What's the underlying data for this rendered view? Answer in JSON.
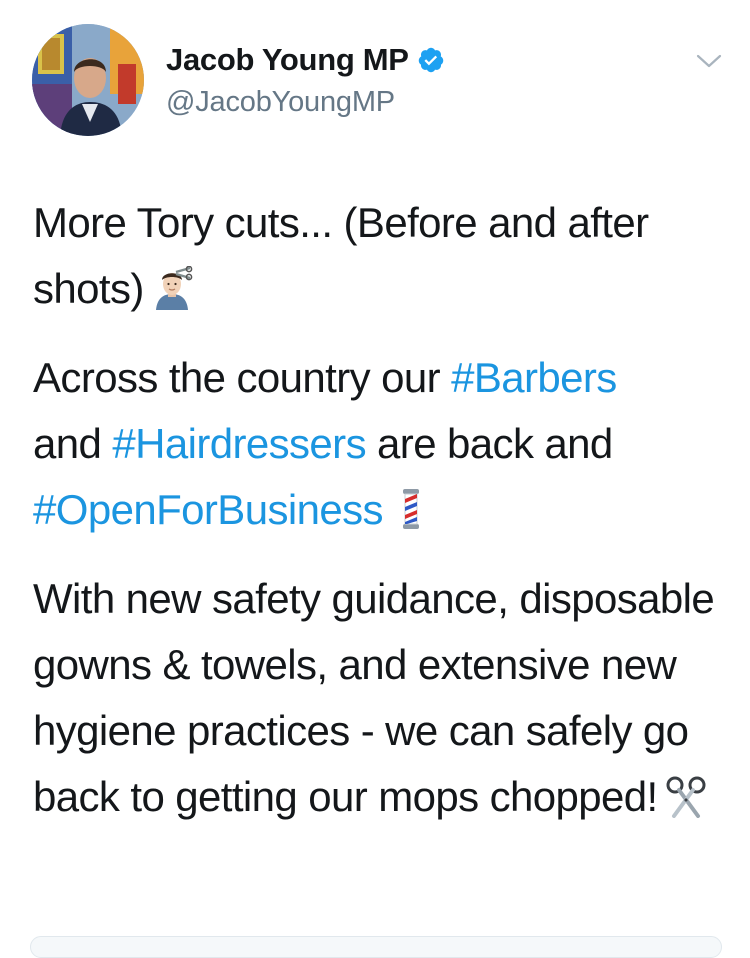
{
  "header": {
    "display_name": "Jacob Young MP",
    "handle": "@JacobYoungMP",
    "verified_icon": "verified-badge-icon",
    "menu_icon": "chevron-down-icon"
  },
  "tweet": {
    "p1_text": "More Tory cuts... (Before and after shots)",
    "p1_emoji": "haircut-icon",
    "p2_text_a": "Across the country our ",
    "p2_hashtag_1": "#Barbers",
    "p2_text_b": "and ",
    "p2_hashtag_2": "#Hairdressers",
    "p2_text_c": " are back and",
    "p2_hashtag_3": "#OpenForBusiness",
    "p2_emoji": "barber-pole-icon",
    "p3_text": "With new safety guidance, disposable gowns & towels, and extensive new hygiene practices - we can safely go back to getting our mops chopped!",
    "p3_emoji": "scissors-icon"
  },
  "colors": {
    "text": "#14171a",
    "secondary_text": "#657786",
    "link": "#1b95e0",
    "verified": "#1da1f2"
  }
}
